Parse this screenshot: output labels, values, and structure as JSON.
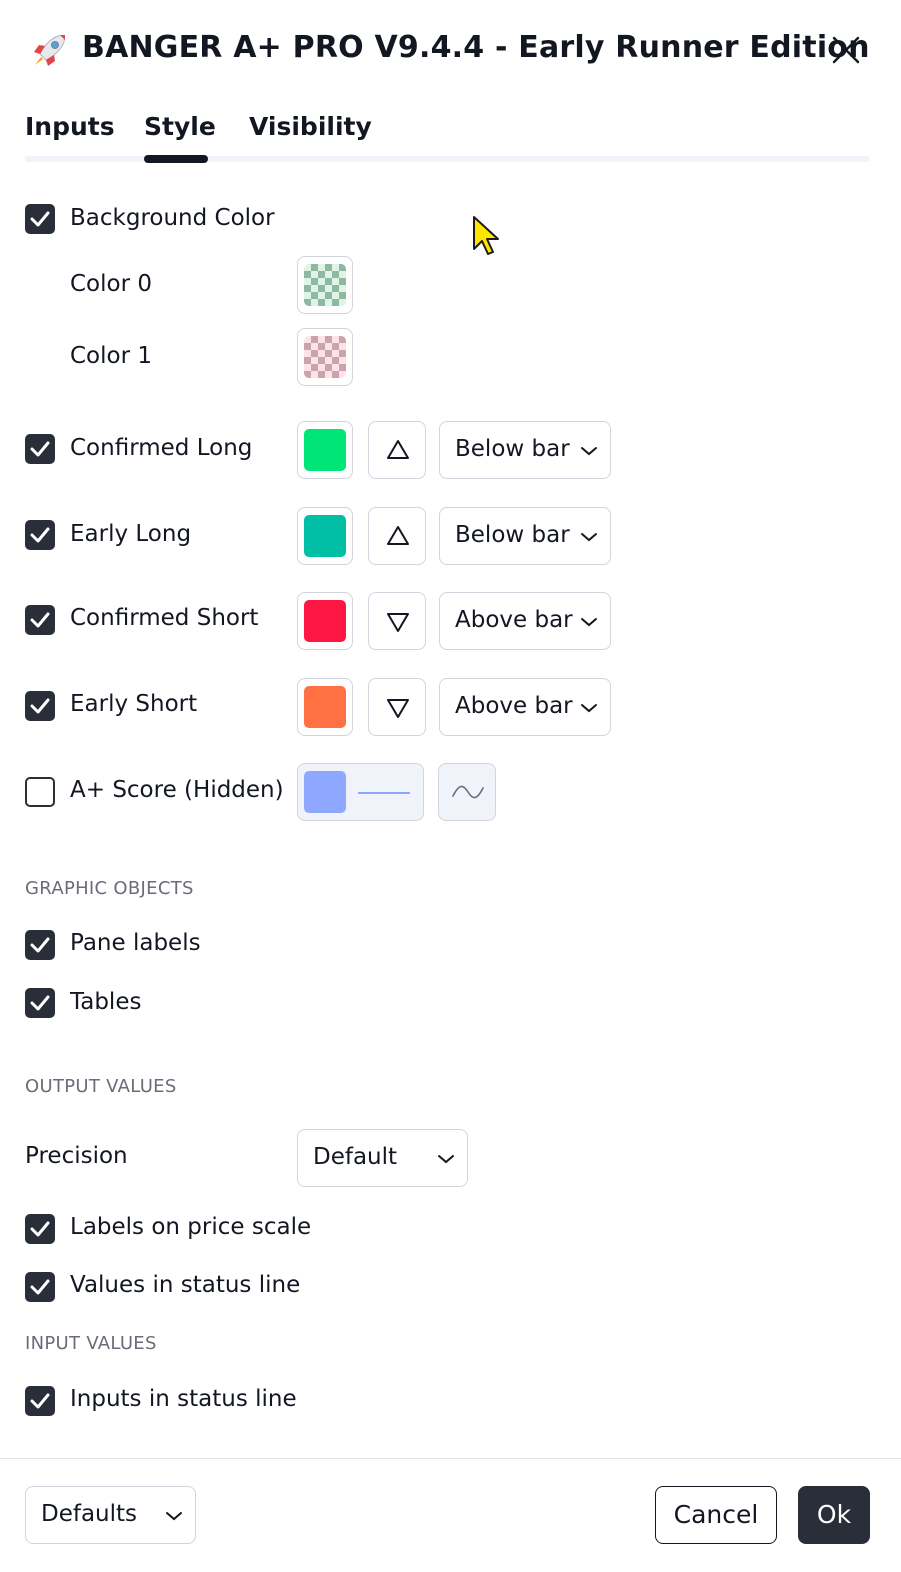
{
  "dialog": {
    "title": "BANGER A+ PRO V9.4.4 - Early Runner Edition",
    "icon": "rocket-icon"
  },
  "tabs": [
    {
      "label": "Inputs",
      "active": false
    },
    {
      "label": "Style",
      "active": true
    },
    {
      "label": "Visibility",
      "active": false
    }
  ],
  "background": {
    "label": "Background Color",
    "checked": true,
    "color0_label": "Color 0",
    "color1_label": "Color 1",
    "color0": "#8fb8a0",
    "color1": "#c9a3ad"
  },
  "plots": [
    {
      "label": "Confirmed Long",
      "checked": true,
      "color": "#00e676",
      "shape": "triangle-up-icon",
      "location": "Below bar"
    },
    {
      "label": "Early Long",
      "checked": true,
      "color": "#00bfa5",
      "shape": "triangle-up-icon",
      "location": "Below bar"
    },
    {
      "label": "Confirmed Short",
      "checked": true,
      "color": "#ff1744",
      "shape": "triangle-down-icon",
      "location": "Above bar"
    },
    {
      "label": "Early Short",
      "checked": true,
      "color": "#ff7043",
      "shape": "triangle-down-icon",
      "location": "Above bar"
    }
  ],
  "score": {
    "label": "A+ Score (Hidden)",
    "checked": false,
    "color": "#8fa8ff"
  },
  "graphic_objects": {
    "header": "GRAPHIC OBJECTS",
    "items": [
      {
        "label": "Pane labels",
        "checked": true
      },
      {
        "label": "Tables",
        "checked": true
      }
    ]
  },
  "output_values": {
    "header": "OUTPUT VALUES",
    "precision_label": "Precision",
    "precision_value": "Default",
    "items": [
      {
        "label": "Labels on price scale",
        "checked": true
      },
      {
        "label": "Values in status line",
        "checked": true
      }
    ]
  },
  "input_values": {
    "header": "INPUT VALUES",
    "items": [
      {
        "label": "Inputs in status line",
        "checked": true
      }
    ]
  },
  "footer": {
    "defaults_label": "Defaults",
    "cancel_label": "Cancel",
    "ok_label": "Ok"
  },
  "colors": {
    "accent": "#131722",
    "checkbox": "#2a2e39"
  }
}
